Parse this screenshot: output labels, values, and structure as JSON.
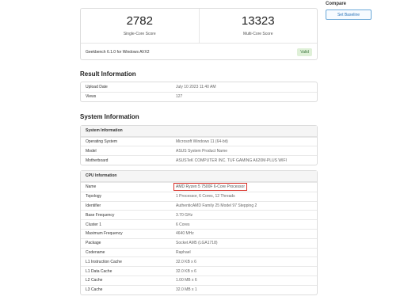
{
  "scores": {
    "single": {
      "value": "2782",
      "label": "Single-Core Score"
    },
    "multi": {
      "value": "13323",
      "label": "Multi-Core Score"
    },
    "version": "Geekbench 6.1.0 for Windows AVX2",
    "badge": "Valid"
  },
  "compare": {
    "title": "Compare",
    "button": "Set Baseline"
  },
  "result": {
    "title": "Result Information",
    "rows": [
      {
        "k": "Upload Date",
        "v": "July 10 2023 11:40 AM"
      },
      {
        "k": "Views",
        "v": "127"
      }
    ]
  },
  "system": {
    "title": "System Information",
    "table_title": "System Information",
    "rows": [
      {
        "k": "Operating System",
        "v": "Microsoft Windows 11 (64-bit)"
      },
      {
        "k": "Model",
        "v": "ASUS System Product Name"
      },
      {
        "k": "Motherboard",
        "v": "ASUSTeK COMPUTER INC. TUF GAMING A620M-PLUS WIFI"
      }
    ]
  },
  "cpu": {
    "table_title": "CPU Information",
    "rows": [
      {
        "k": "Name",
        "v": "AMD Ryzen 5 7500F 6-Core Processor"
      },
      {
        "k": "Topology",
        "v": "1 Processor, 6 Cores, 12 Threads"
      },
      {
        "k": "Identifier",
        "v": "AuthenticAMD Family 25 Model 97 Stepping 2"
      },
      {
        "k": "Base Frequency",
        "v": "3.70 GHz"
      },
      {
        "k": "Cluster 1",
        "v": "6 Cores"
      },
      {
        "k": "Maximum Frequency",
        "v": "4640 MHz"
      },
      {
        "k": "Package",
        "v": "Socket AM5 (LGA1718)"
      },
      {
        "k": "Codename",
        "v": "Raphael"
      },
      {
        "k": "L1 Instruction Cache",
        "v": "32.0 KB x 6"
      },
      {
        "k": "L1 Data Cache",
        "v": "32.0 KB x 6"
      },
      {
        "k": "L2 Cache",
        "v": "1.00 MB x 6"
      },
      {
        "k": "L3 Cache",
        "v": "32.0 MB x 1"
      }
    ]
  }
}
